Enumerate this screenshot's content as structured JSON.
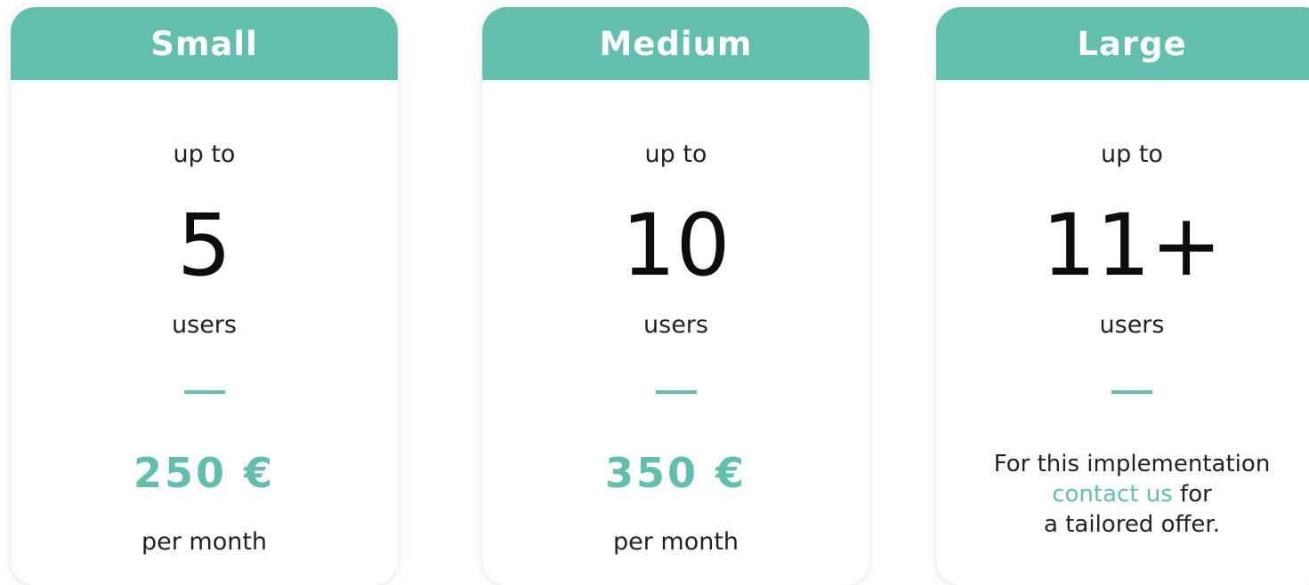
{
  "colors": {
    "accent": "#62bfad",
    "text": "#222222"
  },
  "plans": {
    "small": {
      "name": "Small",
      "up_to": "up to",
      "count": "5",
      "unit": "users",
      "price": "250 €",
      "period": "per month"
    },
    "medium": {
      "name": "Medium",
      "up_to": "up to",
      "count": "10",
      "unit": "users",
      "price": "350 €",
      "period": "per month"
    },
    "large": {
      "name": "Large",
      "up_to": "up to",
      "count": "11+",
      "unit": "users",
      "offer_line1": "For this implementation",
      "offer_link": "contact us",
      "offer_line2_suffix": " for",
      "offer_line3": "a tailored offer."
    }
  }
}
